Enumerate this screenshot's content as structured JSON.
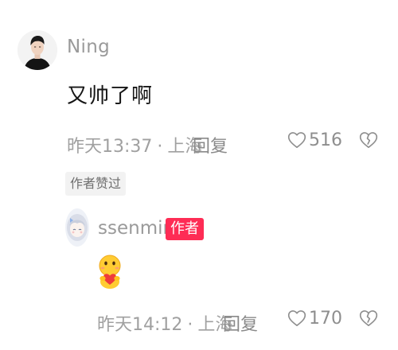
{
  "comment": {
    "username": "Ning",
    "text": "又帅了啊",
    "time": "昨天13:37",
    "separator": "·",
    "location": "上海",
    "reply_label": "回复",
    "likes": "516",
    "author_liked_tag": "作者赞过"
  },
  "reply": {
    "username": "ssenming",
    "author_badge": "作者",
    "content_emoji": "hugging-heart-emoji",
    "time": "昨天14:12",
    "separator": "·",
    "location": "上海",
    "reply_label": "回复",
    "likes": "170"
  },
  "colors": {
    "accent_badge": "#fe2c55",
    "meta_text": "#a0a0a0",
    "primary_text": "#161616"
  },
  "icons": [
    "heart-outline-icon",
    "broken-heart-icon",
    "avatar-man",
    "avatar-anime-girl",
    "hugging-heart-emoji"
  ]
}
